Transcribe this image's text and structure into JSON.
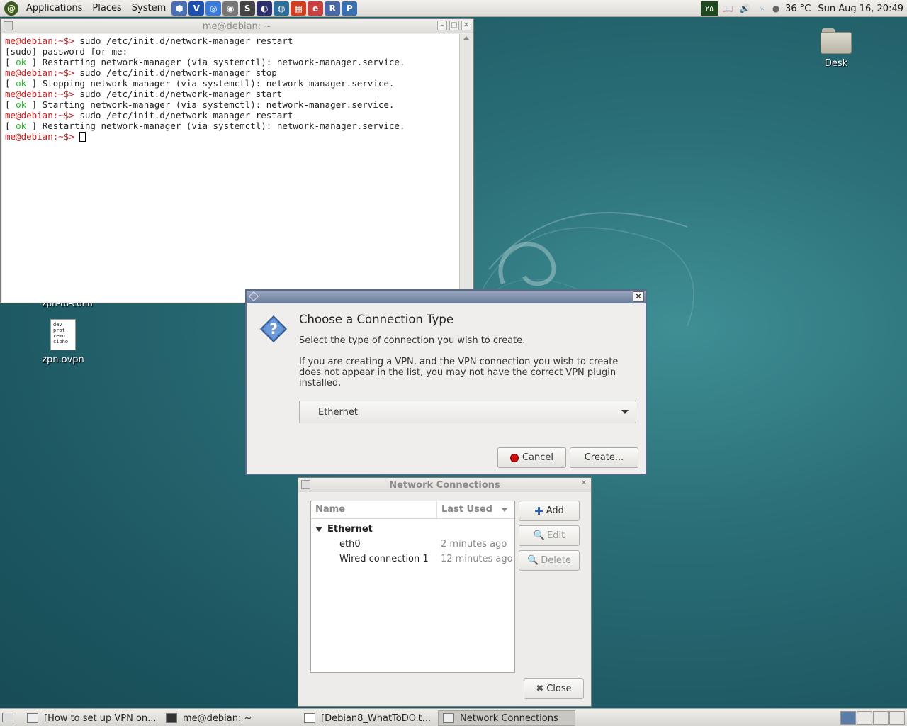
{
  "top_panel": {
    "menus": [
      "Applications",
      "Places",
      "System"
    ],
    "launchers": [
      {
        "icon": "cube-icon",
        "glyph": "⬢",
        "color": "#4a6fb5"
      },
      {
        "icon": "vim-icon",
        "glyph": "V",
        "color": "#1d4fb0"
      },
      {
        "icon": "chromium-icon",
        "glyph": "◎",
        "color": "#3a7ad8"
      },
      {
        "icon": "gear-circle-icon",
        "glyph": "◉",
        "color": "#777777"
      },
      {
        "icon": "sublime-icon",
        "glyph": "S",
        "color": "#444444"
      },
      {
        "icon": "eclipse-icon",
        "glyph": "◐",
        "color": "#2c2e6e"
      },
      {
        "icon": "globe-icon",
        "glyph": "◍",
        "color": "#2e6e9a"
      },
      {
        "icon": "colors-icon",
        "glyph": "▦",
        "color": "#d04020"
      },
      {
        "icon": "editor-icon",
        "glyph": "e",
        "color": "#c84040"
      },
      {
        "icon": "r-icon",
        "glyph": "R",
        "color": "#4a67a8"
      },
      {
        "icon": "python-icon",
        "glyph": "P",
        "color": "#3a6fb0"
      }
    ],
    "tray": {
      "workspace_num": "٢٥",
      "temperature": "36 °C",
      "datetime": "Sun Aug 16, 20:49"
    }
  },
  "desktop": {
    "folder_label": "Desk",
    "file_label": "zpn.ovpn",
    "file_preview": "dev  \nprot\nremo\ncipho",
    "partial_label": "zpn-to-conn"
  },
  "terminal": {
    "title": "me@debian: ~",
    "lines": [
      {
        "prompt": "me@debian:~$> ",
        "text": "sudo /etc/init.d/network-manager restart"
      },
      {
        "text": "[sudo] password for me:"
      },
      {
        "pre": "[ ",
        "ok": "ok",
        "text": " ] Restarting network-manager (via systemctl): network-manager.service."
      },
      {
        "prompt": "me@debian:~$> ",
        "text": "sudo /etc/init.d/network-manager stop"
      },
      {
        "pre": "[ ",
        "ok": "ok",
        "text": " ] Stopping network-manager (via systemctl): network-manager.service."
      },
      {
        "prompt": "me@debian:~$> ",
        "text": "sudo /etc/init.d/network-manager start"
      },
      {
        "pre": "[ ",
        "ok": "ok",
        "text": " ] Starting network-manager (via systemctl): network-manager.service."
      },
      {
        "prompt": "me@debian:~$> ",
        "text": "sudo /etc/init.d/network-manager restart"
      },
      {
        "pre": "[ ",
        "ok": "ok",
        "text": " ] Restarting network-manager (via systemctl): network-manager.service."
      },
      {
        "prompt": "me@debian:~$> ",
        "text": "",
        "cursor": true
      }
    ]
  },
  "dialog": {
    "heading": "Choose a Connection Type",
    "subtitle": "Select the type of connection you wish to create.",
    "info": "If you are creating a VPN, and the VPN connection you wish to create does not appear in the list, you may not have the correct VPN plugin installed.",
    "selected_type": "Ethernet",
    "cancel_label": "Cancel",
    "create_label": "Create..."
  },
  "network_connections": {
    "title": "Network Connections",
    "columns": [
      "Name",
      "Last Used"
    ],
    "group": "Ethernet",
    "rows": [
      {
        "name": "eth0",
        "last_used": "2 minutes ago"
      },
      {
        "name": "Wired connection 1",
        "last_used": "12 minutes ago"
      }
    ],
    "add_label": "Add",
    "edit_label": "Edit",
    "delete_label": "Delete",
    "close_label": "Close"
  },
  "taskbar": {
    "tasks": [
      {
        "label": "[How to set up VPN on...",
        "active": false
      },
      {
        "label": "me@debian: ~",
        "active": false
      },
      {
        "label": "[Debian8_WhatToDO.t...",
        "active": false
      },
      {
        "label": "Network Connections",
        "active": true
      }
    ]
  }
}
